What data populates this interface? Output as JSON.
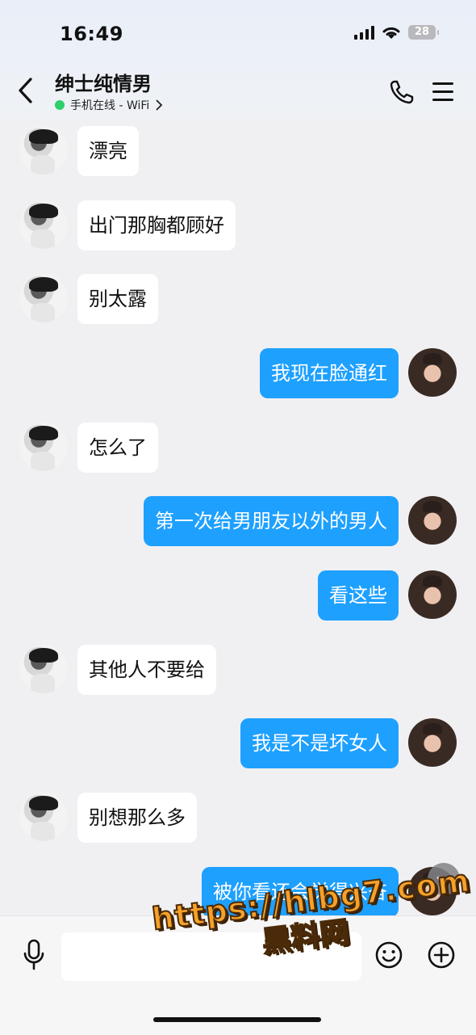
{
  "status_bar": {
    "time": "16:49",
    "battery": "28"
  },
  "header": {
    "title": "绅士纯情男",
    "subtitle": "手机在线 - WiFi",
    "colors": {
      "online": "#2fcf6a"
    }
  },
  "messages": [
    {
      "side": "left",
      "text": "漂亮"
    },
    {
      "side": "left",
      "text": "出门那胸都顾好"
    },
    {
      "side": "left",
      "text": "别太露"
    },
    {
      "side": "right",
      "text": "我现在脸通红"
    },
    {
      "side": "left",
      "text": "怎么了"
    },
    {
      "side": "right",
      "text": "第一次给男朋友以外的男人"
    },
    {
      "side": "right",
      "text": "看这些"
    },
    {
      "side": "left",
      "text": "其他人不要给"
    },
    {
      "side": "right",
      "text": "我是不是坏女人"
    },
    {
      "side": "left",
      "text": "别想那么多"
    },
    {
      "side": "right",
      "text": "被你看还会觉得兴奋"
    }
  ],
  "watermark": {
    "line1": "https://hlbg7.com",
    "line2": "黑料网"
  },
  "colors": {
    "bubble_right": "#1ea0ff",
    "bubble_left": "#ffffff",
    "background": "#f0f0f2"
  },
  "icons": [
    "back-chevron-icon",
    "phone-icon",
    "menu-icon",
    "scroll-down-icon",
    "microphone-icon",
    "emoji-icon",
    "plus-icon"
  ]
}
